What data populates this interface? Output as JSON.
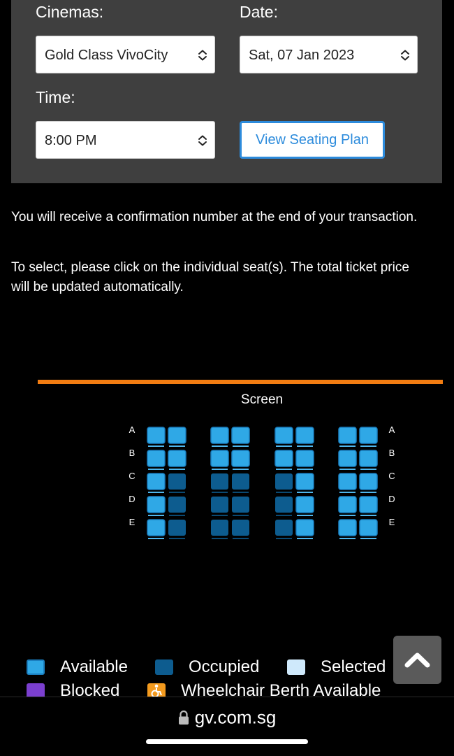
{
  "filters": {
    "cinemas_label": "Cinemas:",
    "cinema_value": "Gold Class VivoCity",
    "date_label": "Date:",
    "date_value": "Sat, 07 Jan 2023",
    "time_label": "Time:",
    "time_value": "8:00 PM",
    "view_button": "View Seating Plan"
  },
  "info": {
    "line1": "You will receive a confirmation number at the end of your transaction.",
    "line2": "To select, please click on the individual seat(s). The total ticket price will be updated automatically."
  },
  "seat_map": {
    "screen_label": "Screen",
    "rows": [
      "A",
      "B",
      "C",
      "D",
      "E"
    ],
    "blocks": 4,
    "seats_per_block": 2,
    "occupied": {
      "C": [
        2,
        3,
        4,
        5
      ],
      "D": [
        2,
        3,
        4,
        5
      ],
      "E": [
        2,
        3,
        4,
        5
      ]
    }
  },
  "legend": {
    "available": "Available",
    "occupied": "Occupied",
    "selected": "Selected",
    "blocked": "Blocked",
    "wheelchair": "Wheelchair Berth Available"
  },
  "colors": {
    "available": "#2fa8e6",
    "occupied": "#0d5c8f",
    "selected": "#cfe9fb",
    "blocked": "#7b3fcf",
    "wheelchair": "#f39a1e",
    "screen": "#f27d12"
  },
  "browser": {
    "url": "gv.com.sg"
  }
}
